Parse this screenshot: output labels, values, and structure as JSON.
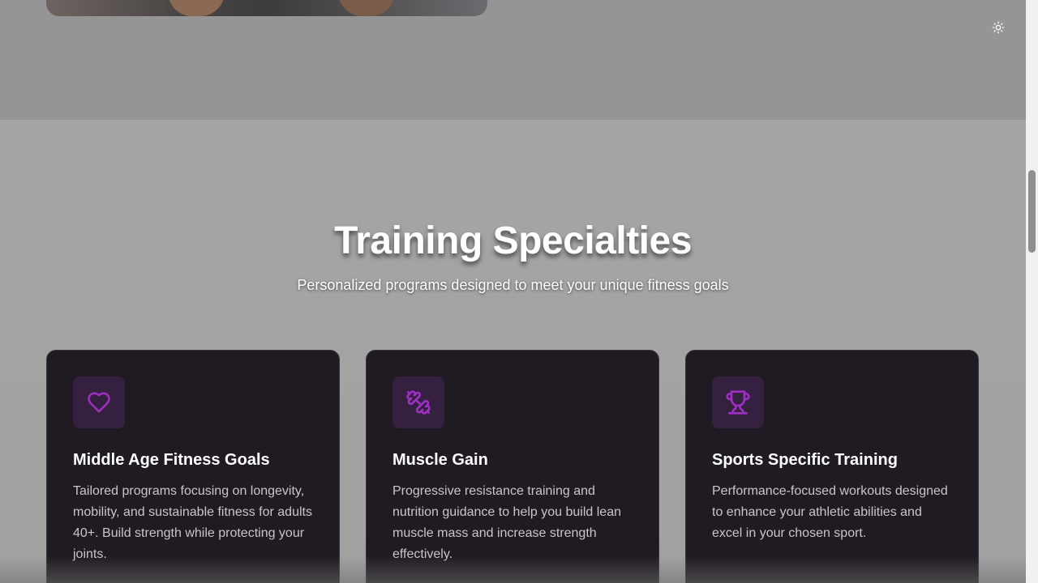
{
  "header": {
    "theme_toggle_icon": "sun-icon"
  },
  "specialties": {
    "title": "Training Specialties",
    "subtitle": "Personalized programs designed to meet your unique fitness goals",
    "cards": [
      {
        "icon": "heart-icon",
        "title": "Middle Age Fitness Goals",
        "description": "Tailored programs focusing on longevity, mobility, and sustainable fitness for adults 40+. Build strength while protecting your joints."
      },
      {
        "icon": "dumbbell-icon",
        "title": "Muscle Gain",
        "description": "Progressive resistance training and nutrition guidance to help you build lean muscle mass and increase strength effectively."
      },
      {
        "icon": "trophy-icon",
        "title": "Sports Specific Training",
        "description": "Performance-focused workouts designed to enhance your athletic abilities and excel in your chosen sport."
      }
    ]
  },
  "colors": {
    "accent": "#9d2fc4",
    "card_bg": "#201b22",
    "icon_bg": "#36203f"
  }
}
